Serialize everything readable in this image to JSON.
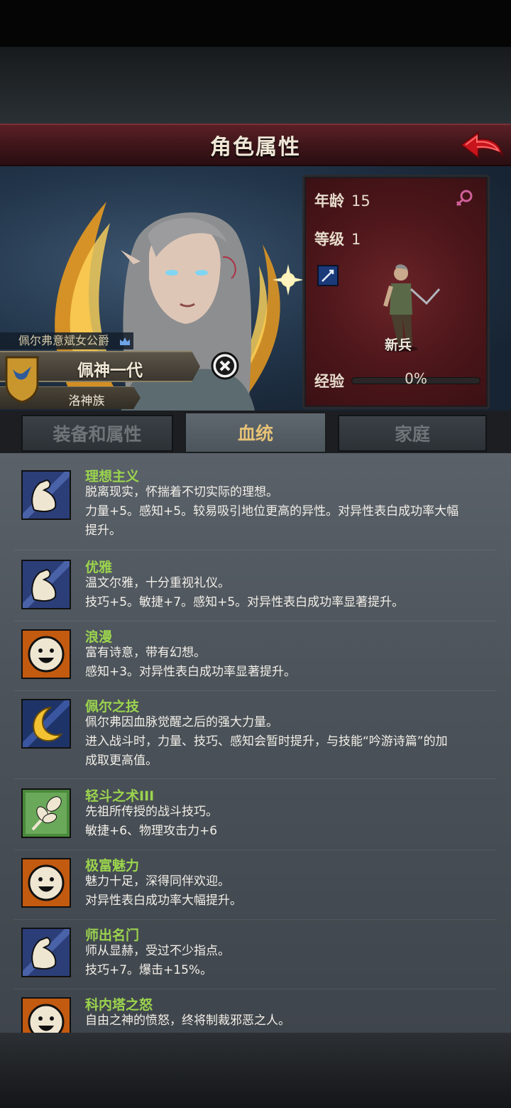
{
  "header": {
    "title": "角色属性"
  },
  "character": {
    "noble_title": "佩尔弗意斌女公爵",
    "name": "佩神一代",
    "race": "洛神族",
    "age_label": "年龄",
    "age": "15",
    "level_label": "等级",
    "level": "1",
    "class": "新兵",
    "exp_label": "经验",
    "exp_text": "0%",
    "exp_progress": 0,
    "gender_color": "#d0609a"
  },
  "tabs": [
    {
      "label": "装备和属性",
      "active": false
    },
    {
      "label": "血统",
      "active": true
    },
    {
      "label": "家庭",
      "active": false
    }
  ],
  "traits": [
    {
      "icon": "arm-strength-icon",
      "name": "理想主义",
      "lines": [
        "脱离现实，怀揣着不切实际的理想。",
        "力量+5。感知+5。较易吸引地位更高的异性。对异性表白成功率大幅",
        "提升。"
      ]
    },
    {
      "icon": "arm-strength-icon",
      "name": "优雅",
      "lines": [
        "温文尔雅，十分重视礼仪。",
        "技巧+5。敏捷+7。感知+5。对异性表白成功率显著提升。"
      ]
    },
    {
      "icon": "smiley-face-icon",
      "name": "浪漫",
      "lines": [
        "富有诗意，带有幻想。",
        "感知+3。对异性表白成功率显著提升。"
      ]
    },
    {
      "icon": "crescent-moon-icon",
      "name": "佩尔之技",
      "lines": [
        "佩尔弗因血脉觉醒之后的强大力量。",
        "进入战斗时，力量、技巧、感知会暂时提升，与技能“吟游诗篇”的加",
        "成取更高值。"
      ]
    },
    {
      "icon": "leaf-branch-icon",
      "name": "轻斗之术III",
      "lines": [
        "先祖所传授的战斗技巧。",
        "敏捷+6、物理攻击力+6"
      ]
    },
    {
      "icon": "smiley-face-icon",
      "name": "极富魅力",
      "lines": [
        "魅力十足，深得同伴欢迎。",
        "对异性表白成功率大幅提升。"
      ]
    },
    {
      "icon": "arm-strength-icon",
      "name": "师出名门",
      "lines": [
        "师从显赫，受过不少指点。",
        "技巧+7。爆击+15%。"
      ]
    },
    {
      "icon": "smiley-face-icon",
      "name": "科内塔之怒",
      "lines": [
        "自由之神的愤怒，终将制裁邪恶之人。"
      ]
    }
  ]
}
